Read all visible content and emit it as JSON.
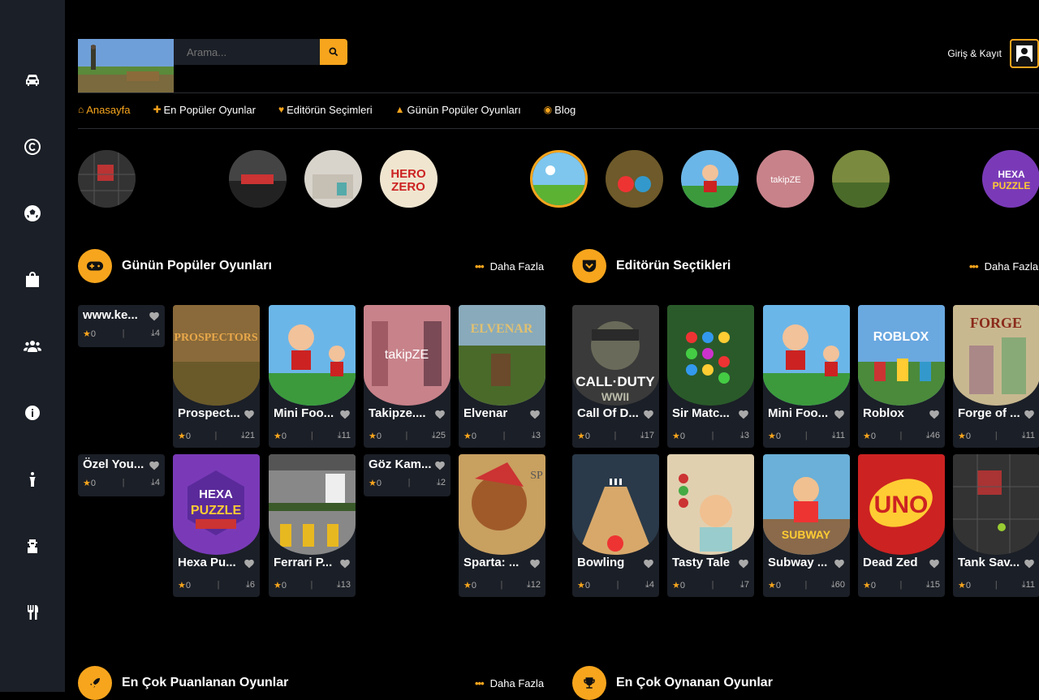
{
  "colors": {
    "accent": "#f7a51d",
    "sidebar": "#1b1f27",
    "card": "#1b1f27"
  },
  "sidebar": {
    "icons": [
      "car-icon",
      "copyright-icon",
      "soccer-ball-icon",
      "shopping-bag-icon",
      "users-icon",
      "info-icon",
      "child-icon",
      "character-icon",
      "restaurant-icon"
    ]
  },
  "header": {
    "search_placeholder": "Arama...",
    "login": "Giriş & Kayıt"
  },
  "nav": [
    {
      "label": "Anasayfa",
      "icon": "home-icon"
    },
    {
      "label": "En Popüler Oyunlar",
      "icon": "puzzle-icon"
    },
    {
      "label": "Editörün Seçimleri",
      "icon": "heart-icon"
    },
    {
      "label": "Günün Popüler Oyunları",
      "icon": "fire-icon"
    },
    {
      "label": "Blog",
      "icon": "rss-icon"
    }
  ],
  "sections": {
    "daily": {
      "title": "Günün Popüler Oyunları",
      "more": "Daha Fazla"
    },
    "editor": {
      "title": "Editörün Seçtikleri",
      "more": "Daha Fazla"
    },
    "rated": {
      "title": "En Çok Puanlanan Oyunlar",
      "more": "Daha Fazla"
    },
    "played": {
      "title": "En Çok Oynanan Oyunlar"
    }
  },
  "daily_games": [
    {
      "name": "www.ke...",
      "likes": "0",
      "downloads": "4"
    },
    {
      "name": "Prospect...",
      "likes": "0",
      "downloads": "21"
    },
    {
      "name": "Mini Foo...",
      "likes": "0",
      "downloads": "11"
    },
    {
      "name": "Takipze....",
      "likes": "0",
      "downloads": "25"
    },
    {
      "name": "Elvenar",
      "likes": "0",
      "downloads": "3"
    },
    {
      "name": "Özel You...",
      "likes": "0",
      "downloads": "4"
    },
    {
      "name": "Hexa Pu...",
      "likes": "0",
      "downloads": "6"
    },
    {
      "name": "Ferrari P...",
      "likes": "0",
      "downloads": "13"
    },
    {
      "name": "Göz Kam...",
      "likes": "0",
      "downloads": "2"
    },
    {
      "name": "Sparta: ...",
      "likes": "0",
      "downloads": "12"
    }
  ],
  "editor_games": [
    {
      "name": "Call Of D...",
      "likes": "0",
      "downloads": "17"
    },
    {
      "name": "Sir Matc...",
      "likes": "0",
      "downloads": "3"
    },
    {
      "name": "Mini Foo...",
      "likes": "0",
      "downloads": "11"
    },
    {
      "name": "Roblox",
      "likes": "0",
      "downloads": "46"
    },
    {
      "name": "Forge of ...",
      "likes": "0",
      "downloads": "11"
    },
    {
      "name": "Bowling",
      "likes": "0",
      "downloads": "4"
    },
    {
      "name": "Tasty Tale",
      "likes": "0",
      "downloads": "7"
    },
    {
      "name": "Subway ...",
      "likes": "0",
      "downloads": "60"
    },
    {
      "name": "Dead Zed",
      "likes": "0",
      "downloads": "15"
    },
    {
      "name": "Tank Sav...",
      "likes": "0",
      "downloads": "11"
    }
  ]
}
